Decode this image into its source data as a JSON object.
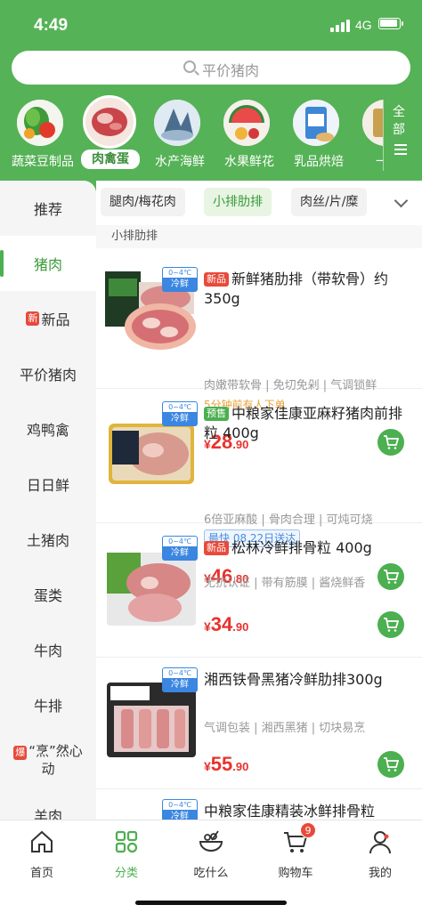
{
  "status": {
    "time": "4:49",
    "network": "4G"
  },
  "search": {
    "placeholder": "平价猪肉"
  },
  "categories": [
    {
      "label": "蔬菜豆制品",
      "active": false
    },
    {
      "label": "肉禽蛋",
      "active": true
    },
    {
      "label": "水产海鲜",
      "active": false
    },
    {
      "label": "水果鲜花",
      "active": false
    },
    {
      "label": "乳品烘焙",
      "active": false
    },
    {
      "label": "一日",
      "active": false
    }
  ],
  "all_button": {
    "label": "全部"
  },
  "sidebar": {
    "items": [
      {
        "label": "推荐"
      },
      {
        "label": "猪肉",
        "active": true
      },
      {
        "label": "新品",
        "badge": "新"
      },
      {
        "label": "平价猪肉"
      },
      {
        "label": "鸡鸭禽"
      },
      {
        "label": "日日鲜"
      },
      {
        "label": "土猪肉"
      },
      {
        "label": "蛋类"
      },
      {
        "label": "牛肉"
      },
      {
        "label": "牛排"
      },
      {
        "label": "“烹”然心动",
        "badge": "爆"
      },
      {
        "label": "羊肉"
      }
    ]
  },
  "subtabs": [
    {
      "label": "腿肉/梅花肉"
    },
    {
      "label": "小排肋排",
      "active": true
    },
    {
      "label": "肉丝/片/糜"
    }
  ],
  "section_title": "小排肋排",
  "cold_badge": {
    "range": "0~4℃",
    "label": "冷鲜"
  },
  "products": [
    {
      "tag": "新品",
      "tag_type": "new",
      "title": "新鲜猪肋排（带软骨）约350g",
      "desc": "肉嫩带软骨 | 免切免剁 | 气调锁鲜",
      "note": "5分钟前有人下单",
      "price_int": "28",
      "price_dec": ".90"
    },
    {
      "tag": "预售",
      "tag_type": "pre",
      "title": "中粮家佳康亚麻籽猪肉前排粒 400g",
      "desc": "6倍亚麻酸 | 骨肉合理 | 可炖可烧",
      "deliver": "最快 08.22日送达",
      "price_int": "46",
      "price_dec": ".80"
    },
    {
      "tag": "新品",
      "tag_type": "new",
      "title": "松林冷鲜排骨粒 400g",
      "desc": "无抗认证 | 带有筋膜 | 酱烧鲜香",
      "price_int": "34",
      "price_dec": ".90"
    },
    {
      "tag": "",
      "title": "湘西铁骨黑猪冷鲜肋排300g",
      "desc": "气调包装 | 湘西黑猪 | 切块易烹",
      "price_int": "55",
      "price_dec": ".90"
    },
    {
      "tag": "",
      "title": "中粮家佳康精装冰鲜排骨粒",
      "desc": "",
      "price_int": "",
      "price_dec": ""
    }
  ],
  "currency": "¥",
  "tabbar": {
    "items": [
      {
        "label": "首页",
        "icon": "home-icon"
      },
      {
        "label": "分类",
        "icon": "category-icon",
        "active": true
      },
      {
        "label": "吃什么",
        "icon": "bowl-icon"
      },
      {
        "label": "购物车",
        "icon": "cart-icon",
        "count": "9"
      },
      {
        "label": "我的",
        "icon": "user-icon"
      }
    ]
  },
  "colors": {
    "brand_green": "#56b256",
    "price_red": "#e8322d",
    "accent_green": "#4caf50"
  }
}
